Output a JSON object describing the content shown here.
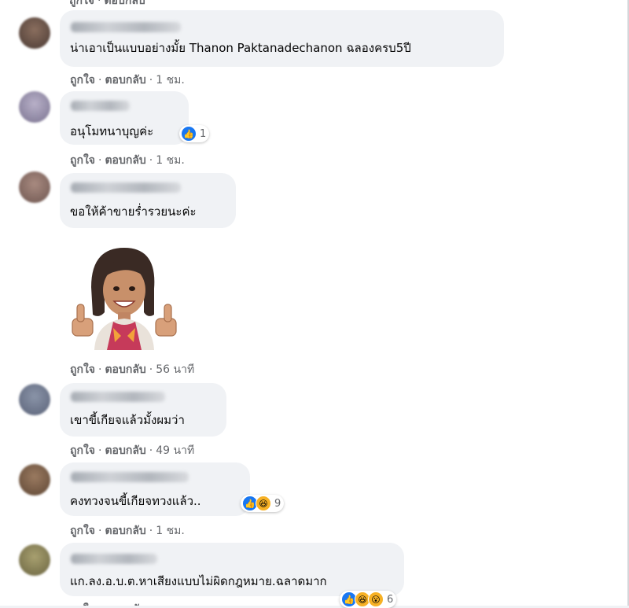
{
  "actions": {
    "like": "ถูกใจ",
    "reply": "ตอบกลับ",
    "separator": "·"
  },
  "comments": [
    {
      "text": "น่าเอาเป็นแบบอย่างมั้ย Thanon Paktanadechanon ฉลองครบ5ปี",
      "time": "1 ชม."
    },
    {
      "text": "อนุโมทนาบุญค่ะ",
      "time": "1 ชม.",
      "reaction_count": "1",
      "reactions": [
        "like-icon"
      ]
    },
    {
      "text": "ขอให้ค้าขายร่ำรวยนะค่ะ",
      "time": "56 นาที"
    },
    {
      "text": "เขาขี้เกียจแล้วมั้งผมว่า",
      "time": "49 นาที"
    },
    {
      "text": "คงทวงจนขี้เกียจทวงแล้ว..",
      "time": "1 ชม.",
      "reaction_count": "9",
      "reactions": [
        "like-icon",
        "haha-icon"
      ]
    },
    {
      "text": "แก.ลง.อ.บ.ต.หาเสียงแบบไม่ผิดกฎหมาย.ฉลาดมาก",
      "reaction_count": "6",
      "reactions": [
        "like-icon",
        "haha-icon",
        "wow-icon"
      ]
    }
  ],
  "colors": {
    "bubble": "#f0f2f5",
    "action_text": "#65676b",
    "like_blue": "#1877f2",
    "emoji_yellow": "#f7b125"
  }
}
